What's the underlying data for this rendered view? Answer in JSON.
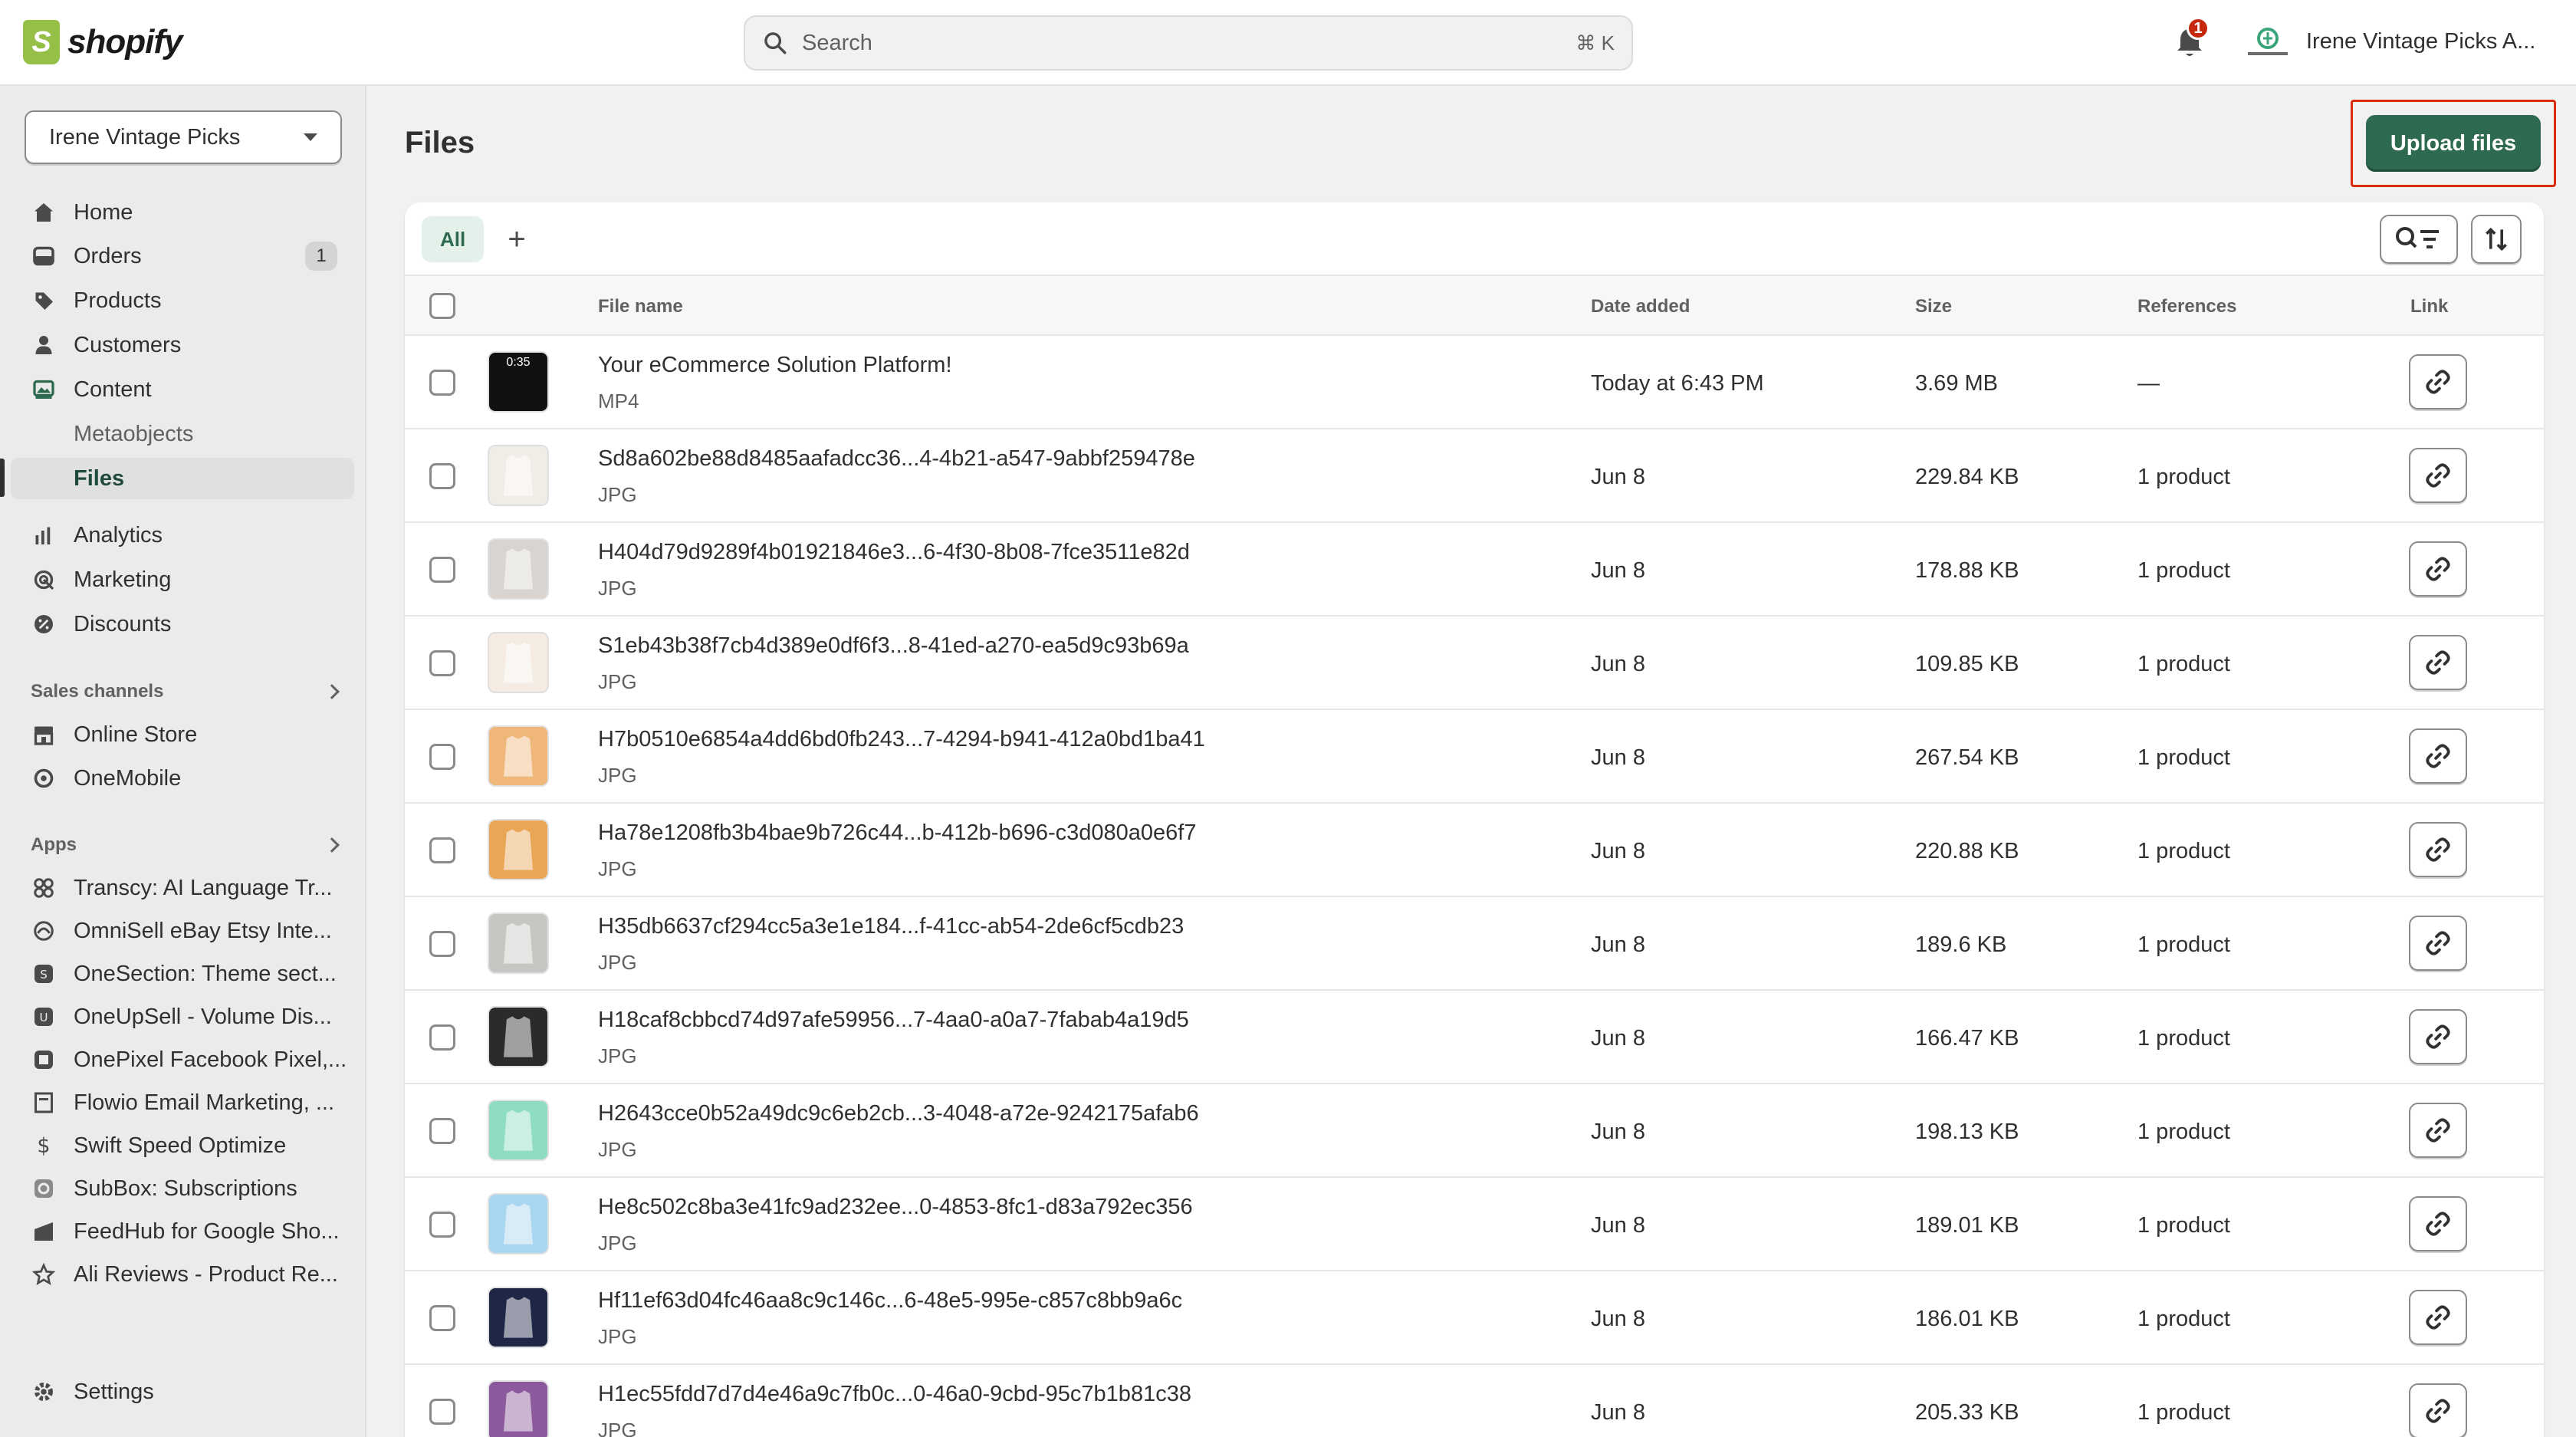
{
  "app": {
    "logo_text": "shopify",
    "search_placeholder": "Search",
    "search_shortcut": "⌘ K",
    "notification_count": "1",
    "store_name": "Irene Vintage Picks A..."
  },
  "sidebar": {
    "store_select": "Irene Vintage Picks",
    "nav": [
      {
        "label": "Home",
        "icon": "home-icon"
      },
      {
        "label": "Orders",
        "icon": "orders-icon",
        "count": "1"
      },
      {
        "label": "Products",
        "icon": "tag-icon"
      },
      {
        "label": "Customers",
        "icon": "person-icon"
      },
      {
        "label": "Content",
        "icon": "content-icon"
      },
      {
        "label": "Metaobjects"
      },
      {
        "label": "Files"
      },
      {
        "label": "Analytics",
        "icon": "bar-chart-icon"
      },
      {
        "label": "Marketing",
        "icon": "target-icon"
      },
      {
        "label": "Discounts",
        "icon": "discount-icon"
      }
    ],
    "sales_channels_heading": "Sales channels",
    "sales_channels": [
      {
        "label": "Online Store",
        "icon": "store-icon"
      },
      {
        "label": "OneMobile",
        "icon": "refresh-icon"
      }
    ],
    "apps_heading": "Apps",
    "apps": [
      {
        "label": "Transcy: AI Language Tr...",
        "icon": "transcy-icon"
      },
      {
        "label": "OmniSell eBay Etsy Inte...",
        "icon": "omnisell-icon"
      },
      {
        "label": "OneSection: Theme sect...",
        "icon": "onesection-icon"
      },
      {
        "label": "OneUpSell - Volume Dis...",
        "icon": "oneupsell-icon"
      },
      {
        "label": "OnePixel Facebook Pixel,...",
        "icon": "onepixel-icon"
      },
      {
        "label": "Flowio Email Marketing, ...",
        "icon": "flowio-icon"
      },
      {
        "label": "Swift Speed Optimize",
        "icon": "dollar-icon"
      },
      {
        "label": "SubBox: Subscriptions",
        "icon": "subbox-icon"
      },
      {
        "label": "FeedHub for Google Sho...",
        "icon": "feedhub-icon"
      },
      {
        "label": "Ali Reviews - Product Re...",
        "icon": "star-icon"
      }
    ],
    "settings_label": "Settings"
  },
  "page": {
    "title": "Files",
    "upload_label": "Upload files",
    "tab_all": "All",
    "tab_add": "+"
  },
  "table": {
    "headers": {
      "file_name": "File name",
      "date_added": "Date added",
      "size": "Size",
      "references": "References",
      "link": "Link"
    },
    "rows": [
      {
        "name": "Your eCommerce Solution Platform!",
        "type": "MP4",
        "date": "Today at 6:43 PM",
        "size": "3.69 MB",
        "refs": "—",
        "thumb_color": "#111111",
        "thumb_label": "0:35"
      },
      {
        "name": "Sd8a602be88d8485aafadcc36...4-4b21-a547-9abbf259478e",
        "type": "JPG",
        "date": "Jun 8",
        "size": "229.84 KB",
        "refs": "1 product",
        "thumb_color": "#f2ece6"
      },
      {
        "name": "H404d79d9289f4b01921846e3...6-4f30-8b08-7fce3511e82d",
        "type": "JPG",
        "date": "Jun 8",
        "size": "178.88 KB",
        "refs": "1 product",
        "thumb_color": "#d9d4cf"
      },
      {
        "name": "S1eb43b38f7cb4d389e0df6f3...8-41ed-a270-ea5d9c93b69a",
        "type": "JPG",
        "date": "Jun 8",
        "size": "109.85 KB",
        "refs": "1 product",
        "thumb_color": "#f4ece2"
      },
      {
        "name": "H7b0510e6854a4dd6bd0fb243...7-4294-b941-412a0bd1ba41",
        "type": "JPG",
        "date": "Jun 8",
        "size": "267.54 KB",
        "refs": "1 product",
        "thumb_color": "#f0b77a"
      },
      {
        "name": "Ha78e1208fb3b4bae9b726c44...b-412b-b696-c3d080a0e6f7",
        "type": "JPG",
        "date": "Jun 8",
        "size": "220.88 KB",
        "refs": "1 product",
        "thumb_color": "#e9a657"
      },
      {
        "name": "H35db6637cf294cc5a3e1e184...f-41cc-ab54-2de6cf5cdb23",
        "type": "JPG",
        "date": "Jun 8",
        "size": "189.6 KB",
        "refs": "1 product",
        "thumb_color": "#c8c6c3"
      },
      {
        "name": "H18caf8cbbcd74d97afe59956...7-4aa0-a0a7-7fabab4a19d5",
        "type": "JPG",
        "date": "Jun 8",
        "size": "166.47 KB",
        "refs": "1 product",
        "thumb_color": "#2b2b2b"
      },
      {
        "name": "H2643cce0b52a49dc9c6eb2cb...3-4048-a72e-9242175afab6",
        "type": "JPG",
        "date": "Jun 8",
        "size": "198.13 KB",
        "refs": "1 product",
        "thumb_color": "#8fdcc4"
      },
      {
        "name": "He8c502c8ba3e41fc9ad232ee...0-4853-8fc1-d83a792ec356",
        "type": "JPG",
        "date": "Jun 8",
        "size": "189.01 KB",
        "refs": "1 product",
        "thumb_color": "#a9d6f0"
      },
      {
        "name": "Hf11ef63d04fc46aa8c9c146c...6-48e5-995e-c857c8bb9a6c",
        "type": "JPG",
        "date": "Jun 8",
        "size": "186.01 KB",
        "refs": "1 product",
        "thumb_color": "#1f2747"
      },
      {
        "name": "H1ec55fdd7d7d4e46a9c7fb0c...0-46a0-9cbd-95c7b1b81c38",
        "type": "JPG",
        "date": "Jun 8",
        "size": "205.33 KB",
        "refs": "1 product",
        "thumb_color": "#8c5a9c"
      }
    ]
  },
  "colors": {
    "accent": "#2d6a4f",
    "highlight": "#d82c0d",
    "badge": "#c5280c"
  }
}
